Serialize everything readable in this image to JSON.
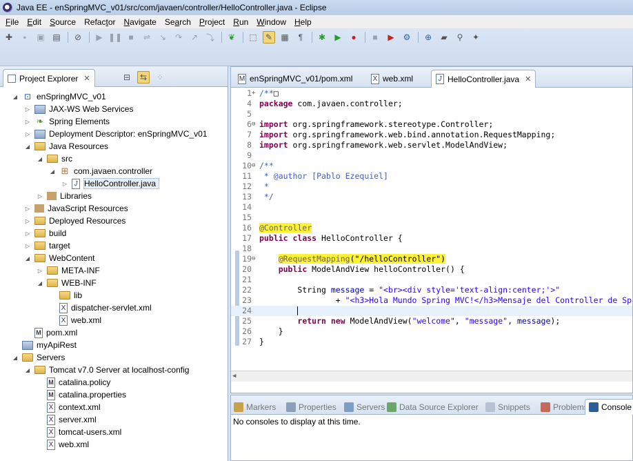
{
  "window": {
    "title": "Java EE - enSpringMVC_v01/src/com/javaen/controller/HelloController.java - Eclipse"
  },
  "menu": [
    {
      "u": "F",
      "rest": "ile"
    },
    {
      "u": "E",
      "rest": "dit"
    },
    {
      "u": "S",
      "rest": "ource"
    },
    {
      "u": "",
      "rest": "Refac",
      "u2": "t",
      "rest2": "or"
    },
    {
      "u": "N",
      "rest": "avigate"
    },
    {
      "u": "",
      "rest": "Se",
      "u2": "a",
      "rest2": "rch"
    },
    {
      "u": "P",
      "rest": "roject"
    },
    {
      "u": "R",
      "rest": "un"
    },
    {
      "u": "W",
      "rest": "indow"
    },
    {
      "u": "H",
      "rest": "elp"
    }
  ],
  "explorer": {
    "title": "Project Explorer",
    "close": "✕",
    "items": [
      {
        "label": "enSpringMVC_v01",
        "indent": 0,
        "twisty": "◢",
        "icon": "proj"
      },
      {
        "label": "JAX-WS Web Services",
        "indent": 1,
        "twisty": "▷",
        "icon": "srv"
      },
      {
        "label": "Spring Elements",
        "indent": 1,
        "twisty": "▷",
        "icon": "jar"
      },
      {
        "label": "Deployment Descriptor: enSpringMVC_v01",
        "indent": 1,
        "twisty": "▷",
        "icon": "srv"
      },
      {
        "label": "Java Resources",
        "indent": 1,
        "twisty": "◢",
        "icon": "folder"
      },
      {
        "label": "src",
        "indent": 2,
        "twisty": "◢",
        "icon": "folder"
      },
      {
        "label": "com.javaen.controller",
        "indent": 3,
        "twisty": "◢",
        "icon": "pkg"
      },
      {
        "label": "HelloController.java",
        "indent": 4,
        "twisty": "▷",
        "icon": "java",
        "selected": true
      },
      {
        "label": "Libraries",
        "indent": 2,
        "twisty": "▷",
        "icon": "lib"
      },
      {
        "label": "JavaScript Resources",
        "indent": 1,
        "twisty": "▷",
        "icon": "lib"
      },
      {
        "label": "Deployed Resources",
        "indent": 1,
        "twisty": "▷",
        "icon": "folder"
      },
      {
        "label": "build",
        "indent": 1,
        "twisty": "▷",
        "icon": "folder"
      },
      {
        "label": "target",
        "indent": 1,
        "twisty": "▷",
        "icon": "folder"
      },
      {
        "label": "WebContent",
        "indent": 1,
        "twisty": "◢",
        "icon": "folder"
      },
      {
        "label": "META-INF",
        "indent": 2,
        "twisty": "▷",
        "icon": "folder"
      },
      {
        "label": "WEB-INF",
        "indent": 2,
        "twisty": "◢",
        "icon": "folder"
      },
      {
        "label": "lib",
        "indent": 3,
        "twisty": "",
        "icon": "folder"
      },
      {
        "label": "dispatcher-servlet.xml",
        "indent": 3,
        "twisty": "",
        "icon": "xml"
      },
      {
        "label": "web.xml",
        "indent": 3,
        "twisty": "",
        "icon": "xml"
      },
      {
        "label": "pom.xml",
        "indent": 1,
        "twisty": "",
        "icon": "file"
      },
      {
        "label": "myApiRest",
        "indent": 0,
        "twisty": "",
        "icon": "srv"
      },
      {
        "label": "Servers",
        "indent": 0,
        "twisty": "◢",
        "icon": "folder"
      },
      {
        "label": "Tomcat v7.0 Server at localhost-config",
        "indent": 1,
        "twisty": "◢",
        "icon": "folder"
      },
      {
        "label": "catalina.policy",
        "indent": 2,
        "twisty": "",
        "icon": "file"
      },
      {
        "label": "catalina.properties",
        "indent": 2,
        "twisty": "",
        "icon": "file"
      },
      {
        "label": "context.xml",
        "indent": 2,
        "twisty": "",
        "icon": "xml"
      },
      {
        "label": "server.xml",
        "indent": 2,
        "twisty": "",
        "icon": "xml"
      },
      {
        "label": "tomcat-users.xml",
        "indent": 2,
        "twisty": "",
        "icon": "xml"
      },
      {
        "label": "web.xml",
        "indent": 2,
        "twisty": "",
        "icon": "xml"
      }
    ]
  },
  "editor": {
    "tabs": [
      {
        "label": "enSpringMVC_v01/pom.xml",
        "icon": "M",
        "active": false
      },
      {
        "label": "web.xml",
        "icon": "X",
        "active": false
      },
      {
        "label": "HelloController.java",
        "icon": "J",
        "active": true,
        "close": "✕"
      }
    ],
    "lines": [
      {
        "n": "1",
        "fold": "+",
        "segs": [
          {
            "c": "cm",
            "t": "/**"
          },
          {
            "c": "",
            "t": "□"
          }
        ]
      },
      {
        "n": "4",
        "fold": "",
        "segs": [
          {
            "c": "kw",
            "t": "package"
          },
          {
            "c": "",
            "t": " com.javaen.controller;"
          }
        ]
      },
      {
        "n": "5",
        "fold": "",
        "segs": []
      },
      {
        "n": "6",
        "fold": "⊖",
        "segs": [
          {
            "c": "kw",
            "t": "import"
          },
          {
            "c": "",
            "t": " org.springframework.stereotype.Controller;"
          }
        ]
      },
      {
        "n": "7",
        "fold": "",
        "segs": [
          {
            "c": "kw",
            "t": "import"
          },
          {
            "c": "",
            "t": " org.springframework.web.bind.annotation.RequestMapping;"
          }
        ]
      },
      {
        "n": "8",
        "fold": "",
        "segs": [
          {
            "c": "kw",
            "t": "import"
          },
          {
            "c": "",
            "t": " org.springframework.web.servlet.ModelAndView;"
          }
        ]
      },
      {
        "n": "9",
        "fold": "",
        "segs": []
      },
      {
        "n": "10",
        "fold": "⊖",
        "segs": [
          {
            "c": "cm",
            "t": "/**"
          }
        ]
      },
      {
        "n": "11",
        "fold": "",
        "segs": [
          {
            "c": "cm",
            "t": " * @author [Pablo Ezequiel]"
          }
        ]
      },
      {
        "n": "12",
        "fold": "",
        "segs": [
          {
            "c": "cm",
            "t": " *"
          }
        ]
      },
      {
        "n": "13",
        "fold": "",
        "segs": [
          {
            "c": "cm",
            "t": " */"
          }
        ]
      },
      {
        "n": "14",
        "fold": "",
        "segs": []
      },
      {
        "n": "15",
        "fold": "",
        "segs": []
      },
      {
        "n": "16",
        "fold": "",
        "segs": [
          {
            "c": "an hl",
            "t": "@Controller"
          }
        ]
      },
      {
        "n": "17",
        "fold": "",
        "segs": [
          {
            "c": "kw",
            "t": "public"
          },
          {
            "c": "",
            "t": " "
          },
          {
            "c": "kw",
            "t": "class"
          },
          {
            "c": "",
            "t": " HelloController {"
          }
        ]
      },
      {
        "n": "18",
        "fold": "",
        "segs": []
      },
      {
        "n": "19",
        "fold": "⊖",
        "segs": [
          {
            "c": "",
            "t": "    "
          },
          {
            "c": "an hl",
            "t": "@RequestMapping"
          },
          {
            "c": "hl",
            "t": "(\"/helloController\")"
          }
        ]
      },
      {
        "n": "20",
        "fold": "",
        "segs": [
          {
            "c": "",
            "t": "    "
          },
          {
            "c": "kw",
            "t": "public"
          },
          {
            "c": "",
            "t": " ModelAndView helloController() {"
          }
        ]
      },
      {
        "n": "21",
        "fold": "",
        "segs": []
      },
      {
        "n": "22",
        "fold": "",
        "segs": [
          {
            "c": "",
            "t": "        String "
          },
          {
            "c": "va",
            "t": "message"
          },
          {
            "c": "",
            "t": " = "
          },
          {
            "c": "st",
            "t": "\"<br><div style='text-align:center;'>\""
          }
        ]
      },
      {
        "n": "23",
        "fold": "",
        "segs": [
          {
            "c": "",
            "t": "                + "
          },
          {
            "c": "st",
            "t": "\"<h3>Hola Mundo Spring MVC!</h3>Mensaje del Controller de Sp"
          }
        ]
      },
      {
        "n": "24",
        "fold": "",
        "segs": [
          {
            "c": "",
            "t": "        "
          }
        ],
        "current": true
      },
      {
        "n": "25",
        "fold": "",
        "segs": [
          {
            "c": "",
            "t": "        "
          },
          {
            "c": "kw",
            "t": "return"
          },
          {
            "c": "",
            "t": " "
          },
          {
            "c": "kw",
            "t": "new"
          },
          {
            "c": "",
            "t": " ModelAndView("
          },
          {
            "c": "st",
            "t": "\"welcome\""
          },
          {
            "c": "",
            "t": ", "
          },
          {
            "c": "st",
            "t": "\"message\""
          },
          {
            "c": "",
            "t": ", "
          },
          {
            "c": "va",
            "t": "message"
          },
          {
            "c": "",
            "t": ");"
          }
        ]
      },
      {
        "n": "26",
        "fold": "",
        "segs": [
          {
            "c": "",
            "t": "    }"
          }
        ]
      },
      {
        "n": "27",
        "fold": "",
        "segs": [
          {
            "c": "",
            "t": "}"
          }
        ]
      }
    ]
  },
  "bottom": {
    "tabs": [
      {
        "label": "Markers",
        "color": "#c9a14a",
        "active": false
      },
      {
        "label": "Properties",
        "color": "#8aa0bb",
        "active": false
      },
      {
        "label": "Servers",
        "color": "#7f9ec4",
        "active": false
      },
      {
        "label": "Data Source Explorer",
        "color": "#6aa56a",
        "active": false
      },
      {
        "label": "Snippets",
        "color": "#b6c3d2",
        "active": false
      },
      {
        "label": "Problems",
        "color": "#c26b5a",
        "active": false
      },
      {
        "label": "Console",
        "color": "#2f5e96",
        "active": true
      }
    ],
    "message": "No consoles to display at this time."
  },
  "colors": {
    "highlight": "#fff235",
    "keyword": "#7f0055",
    "comment": "#3f5fbf",
    "string": "#2a00ff"
  }
}
